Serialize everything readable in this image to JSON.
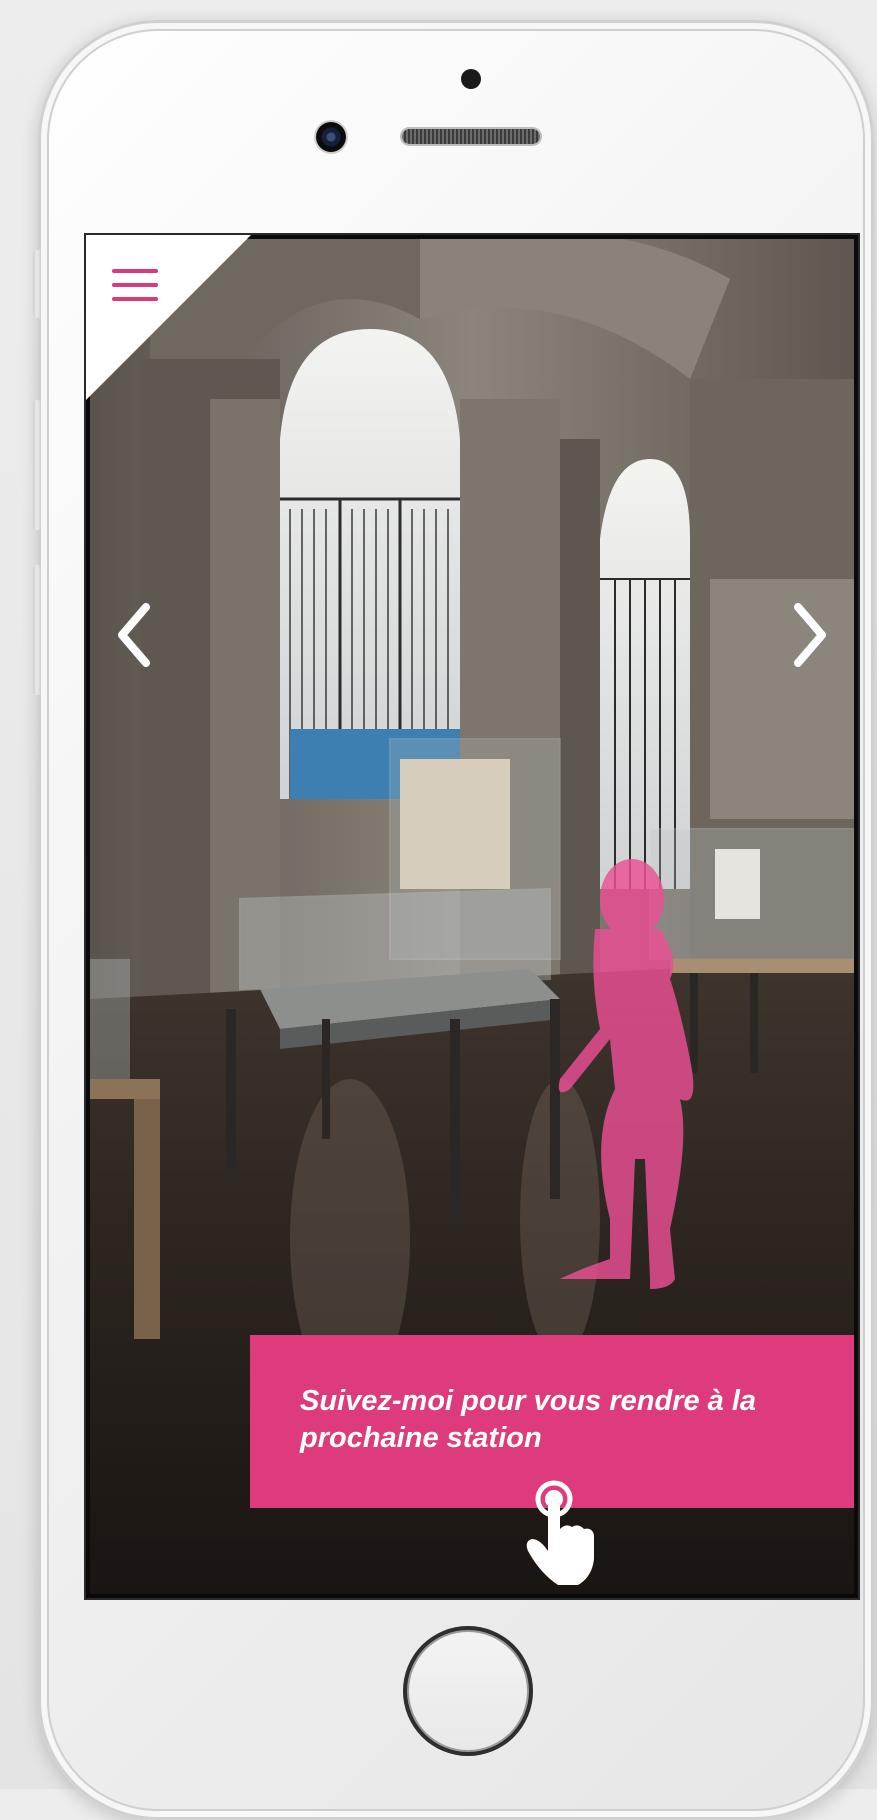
{
  "app": {
    "accent_color": "#dd3b7c",
    "menu_icon": "hamburger-icon",
    "prev_icon": "chevron-left-icon",
    "next_icon": "chevron-right-icon",
    "tap_icon": "tap-hand-icon"
  },
  "guide": {
    "message": "Suivez-moi pour vous rendre à la prochaine station"
  }
}
